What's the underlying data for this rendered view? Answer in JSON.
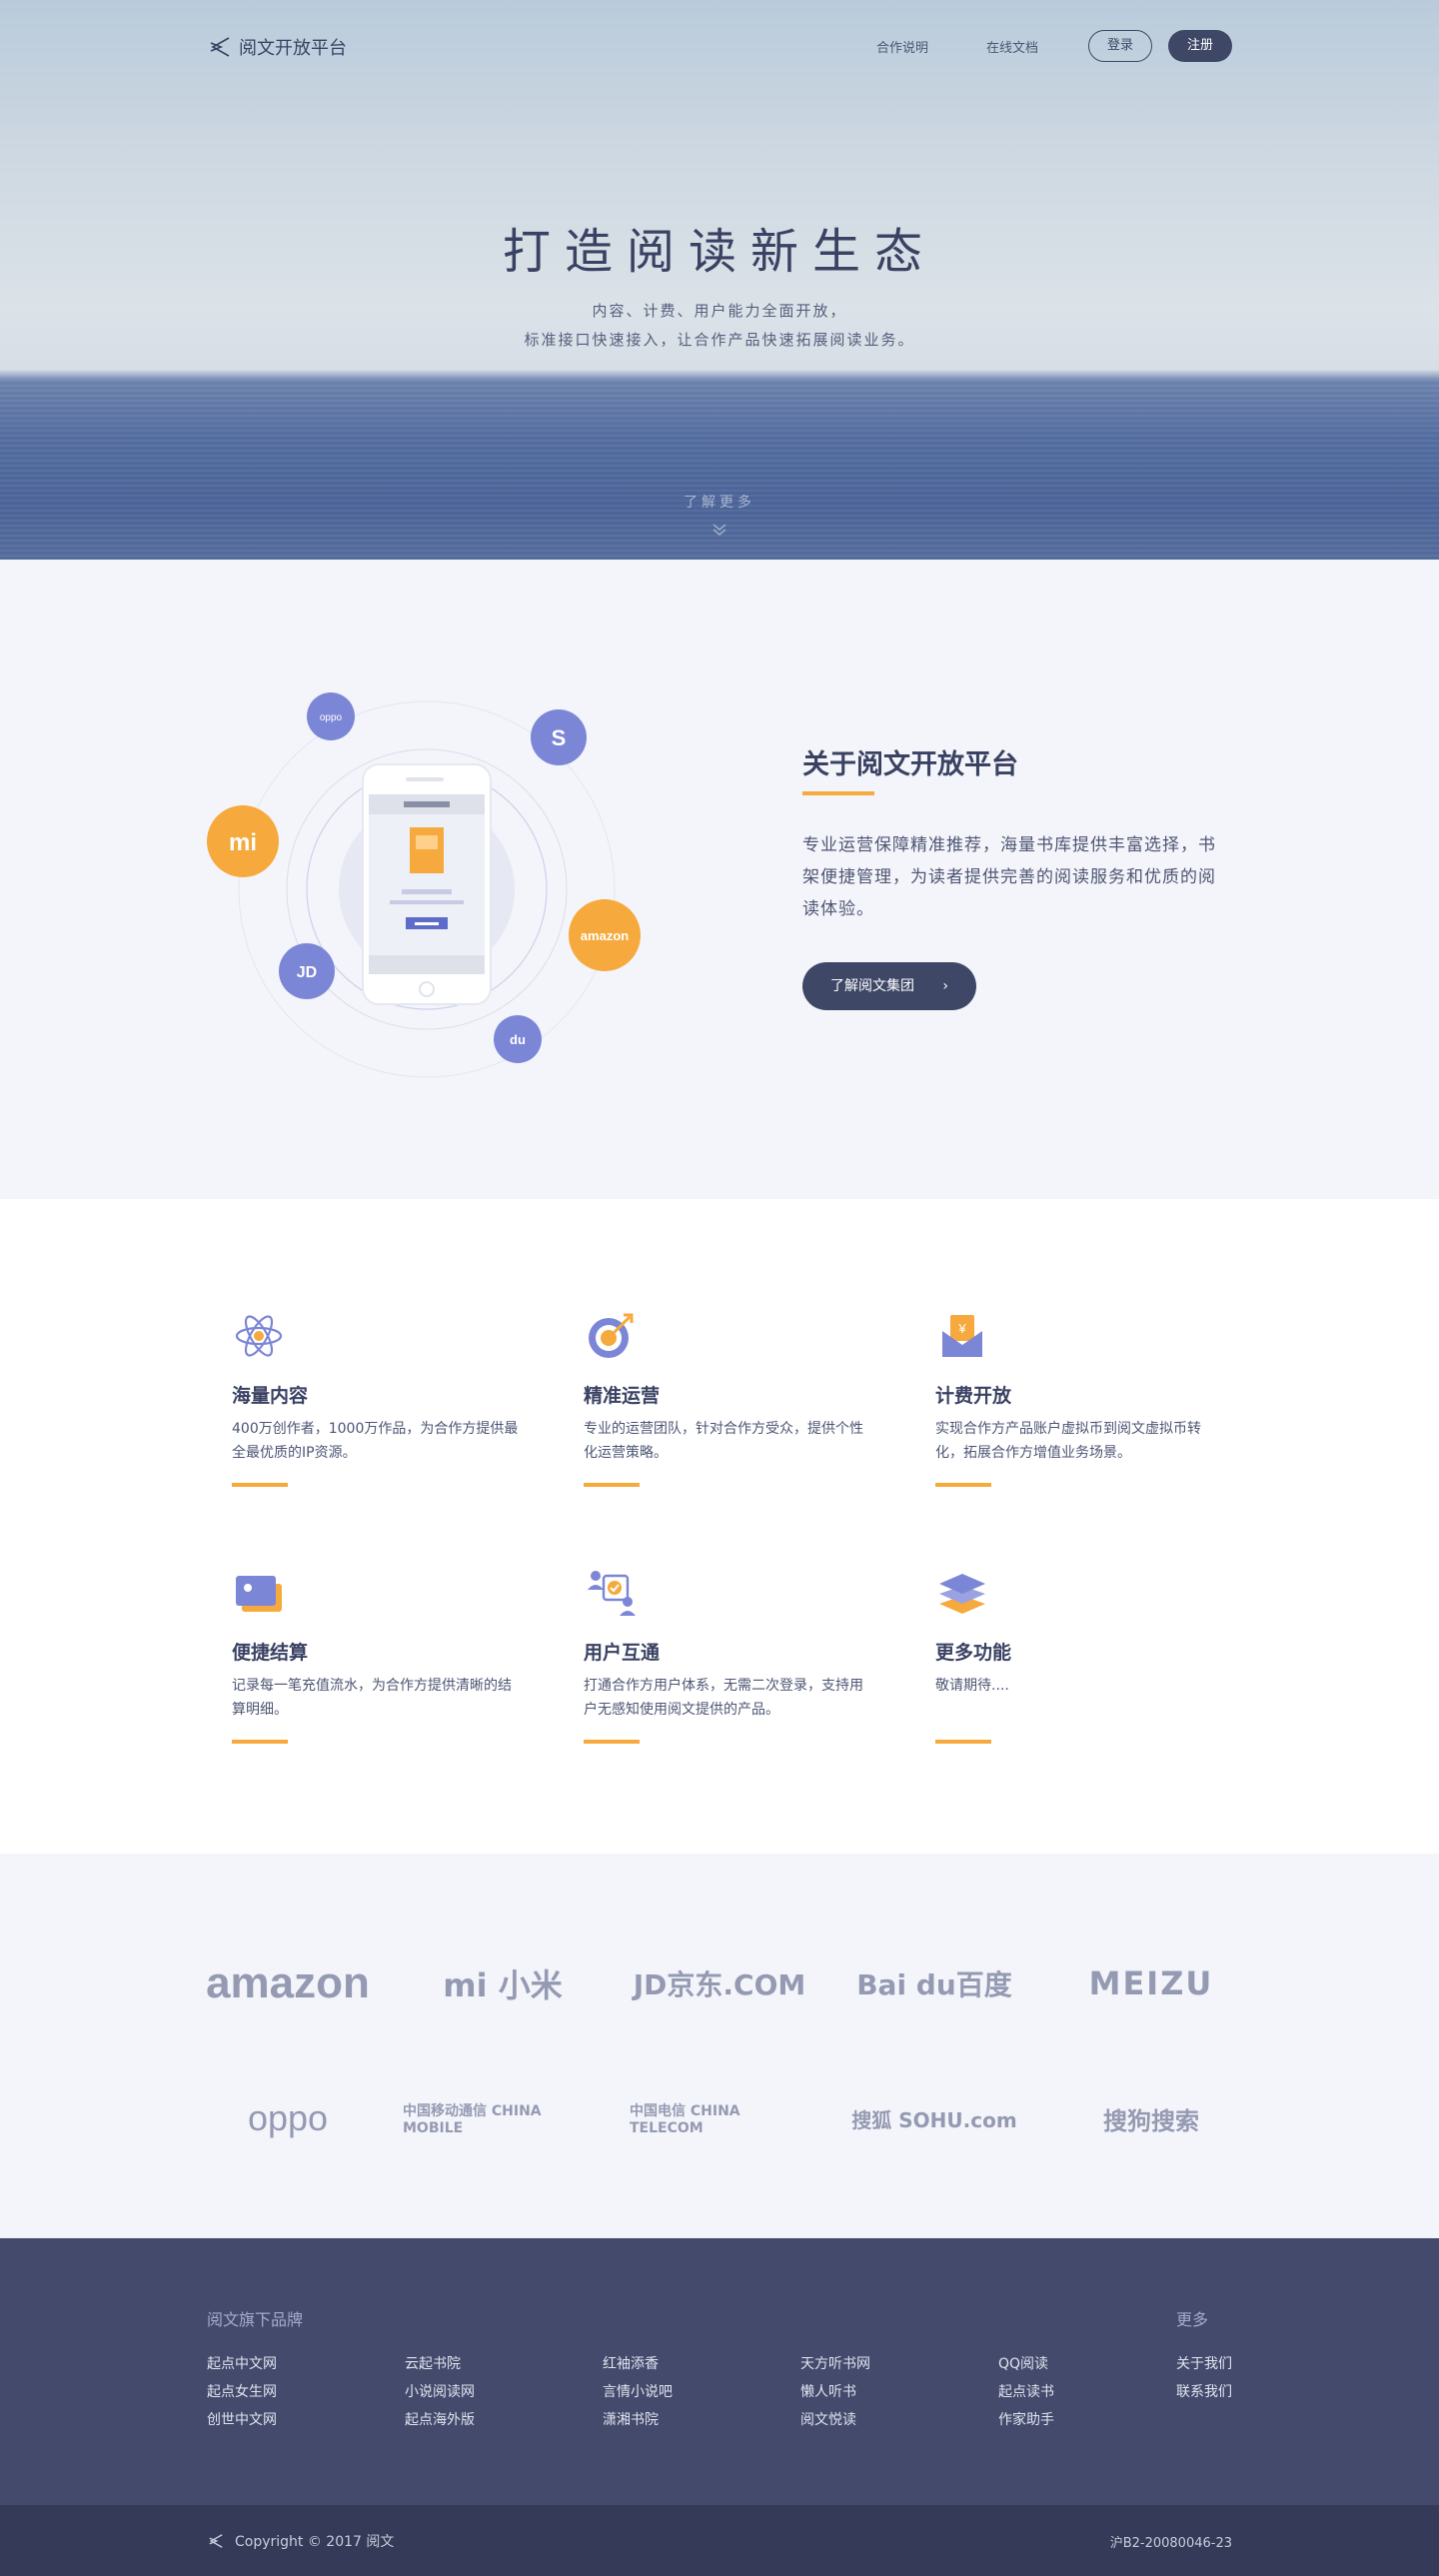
{
  "header": {
    "brand": "阅文开放平台",
    "nav": [
      "合作说明",
      "在线文档"
    ],
    "login": "登录",
    "register": "注册"
  },
  "hero": {
    "title": "打造阅读新生态",
    "subtitle_line1": "内容、计费、用户能力全面开放，",
    "subtitle_line2": "标准接口快速接入，让合作产品快速拓展阅读业务。",
    "learn_more": "了解更多"
  },
  "about": {
    "title": "关于阅文开放平台",
    "text": "专业运营保障精准推荐，海量书库提供丰富选择，书架便捷管理，为读者提供完善的阅读服务和优质的阅读体验。",
    "button": "了解阅文集团",
    "button_arrow": "›",
    "orbit_badges": [
      "oppo",
      "S",
      "mi",
      "amazon",
      "JD",
      "du"
    ]
  },
  "features": [
    {
      "icon": "atom-icon",
      "title": "海量内容",
      "desc": "400万创作者，1000万作品，为合作方提供最全最优质的IP资源。"
    },
    {
      "icon": "target-icon",
      "title": "精准运营",
      "desc": "专业的运营团队，针对合作方受众，提供个性化运营策略。"
    },
    {
      "icon": "envelope-coin-icon",
      "title": "计费开放",
      "desc": "实现合作方产品账户虚拟币到阅文虚拟币转化，拓展合作方增值业务场景。"
    },
    {
      "icon": "wallet-icon",
      "title": "便捷结算",
      "desc": "记录每一笔充值流水，为合作方提供清晰的结算明细。"
    },
    {
      "icon": "users-icon",
      "title": "用户互通",
      "desc": "打通合作方用户体系，无需二次登录，支持用户无感知使用阅文提供的产品。"
    },
    {
      "icon": "layers-icon",
      "title": "更多功能",
      "desc": "敬请期待...."
    }
  ],
  "partners": [
    [
      "amazon",
      "mi 小米",
      "JD京东.COM",
      "Bai du百度",
      "MEIZU"
    ],
    [
      "oppo",
      "中国移动通信 CHINA MOBILE",
      "中国电信 CHINA TELECOM",
      "搜狐 SOHU.com",
      "搜狗搜索"
    ]
  ],
  "footer": {
    "brands_heading": "阅文旗下品牌",
    "more_heading": "更多",
    "columns": [
      [
        "起点中文网",
        "起点女生网",
        "创世中文网"
      ],
      [
        "云起书院",
        "小说阅读网",
        "起点海外版"
      ],
      [
        "红袖添香",
        "言情小说吧",
        "潇湘书院"
      ],
      [
        "天方听书网",
        "懒人听书",
        "阅文悦读"
      ],
      [
        "QQ阅读",
        "起点读书",
        "作家助手"
      ]
    ],
    "more_links": [
      "关于我们",
      "联系我们"
    ],
    "copyright": "Copyright © 2017 阅文",
    "icp": "沪B2-20080046-23"
  },
  "colors": {
    "accent": "#f6a93c",
    "navy": "#3f4766",
    "purple": "#7c86d6",
    "footer": "#434a6c"
  }
}
